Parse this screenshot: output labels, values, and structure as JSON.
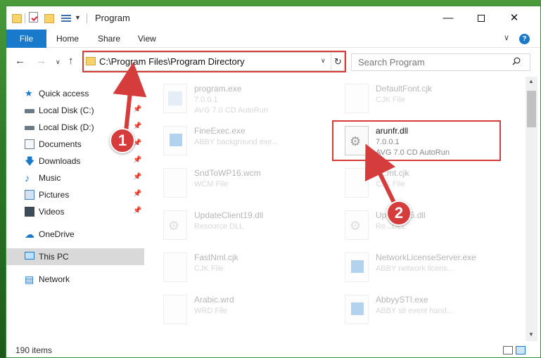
{
  "window": {
    "title": "Program",
    "controls": {
      "minimize": "—",
      "maximize": "",
      "close": "✕"
    }
  },
  "ribbon": {
    "tabs": [
      "File",
      "Home",
      "Share",
      "View"
    ],
    "expand_chevron": "∨",
    "help": "?"
  },
  "nav": {
    "address": "C:\\Program Files\\Program Directory",
    "search_placeholder": "Search Program",
    "back": "←",
    "forward": "→",
    "recent": "∨",
    "up": "↑",
    "refresh": "↻",
    "dropdown": "∨"
  },
  "sidebar": {
    "items": [
      {
        "label": "Quick access",
        "icon": "star-icon"
      },
      {
        "label": "Local Disk (C:)",
        "icon": "drive-icon",
        "pinned": true
      },
      {
        "label": "Local Disk (D:)",
        "icon": "drive-icon",
        "pinned": true
      },
      {
        "label": "Documents",
        "icon": "documents-icon",
        "pinned": true
      },
      {
        "label": "Downloads",
        "icon": "downloads-icon",
        "pinned": true
      },
      {
        "label": "Music",
        "icon": "music-icon",
        "pinned": true
      },
      {
        "label": "Pictures",
        "icon": "pictures-icon",
        "pinned": true
      },
      {
        "label": "Videos",
        "icon": "videos-icon",
        "pinned": true
      },
      {
        "label": "OneDrive",
        "icon": "onedrive-icon"
      },
      {
        "label": "This PC",
        "icon": "this-pc-icon",
        "selected": true
      },
      {
        "label": "Network",
        "icon": "network-icon"
      }
    ],
    "pin_glyph": "📌"
  },
  "files": [
    {
      "name": "program.exe",
      "line2": "7.0.0.1",
      "line3": "AVG 7.0 CD AutoRun",
      "faded": true
    },
    {
      "name": "DefaultFont.cjk",
      "line2": "CJK File",
      "line3": "",
      "faded": true
    },
    {
      "name": "FineExec.exe",
      "line2": "ABBY background exe...",
      "line3": "",
      "faded": true
    },
    {
      "name": "arunfr.dll",
      "line2": "7.0.0.1",
      "line3": "AVG 7.0 CD AutoRun",
      "faded": false,
      "highlighted": true
    },
    {
      "name": "SndToWP16.wcm",
      "line2": "WCM File",
      "line3": "",
      "faded": true
    },
    {
      "name": "fi...mt.cjk",
      "line2": "CJK File",
      "line3": "",
      "faded": true
    },
    {
      "name": "UpdateClient19.dll",
      "line2": "Resource DLL",
      "line3": "",
      "faded": true
    },
    {
      "name": "Up...ent65.dll",
      "line2": "Re...DLL",
      "line3": "",
      "faded": true
    },
    {
      "name": "FastNml.cjk",
      "line2": "CJK File",
      "line3": "",
      "faded": true
    },
    {
      "name": "NetworkLicenseServer.exe",
      "line2": "ABBY network licens...",
      "line3": "",
      "faded": true
    },
    {
      "name": "Arabic.wrd",
      "line2": "WRD File",
      "line3": "",
      "faded": true
    },
    {
      "name": "AbbyySTI.exe",
      "line2": "ABBY sti event hand...",
      "line3": "",
      "faded": true
    }
  ],
  "status": {
    "item_count": "190 items"
  },
  "annotations": {
    "step1": "1",
    "step2": "2"
  },
  "colors": {
    "accent": "#1979ca",
    "highlight_red": "#d53d3d",
    "background_green": "#2f7a28"
  }
}
